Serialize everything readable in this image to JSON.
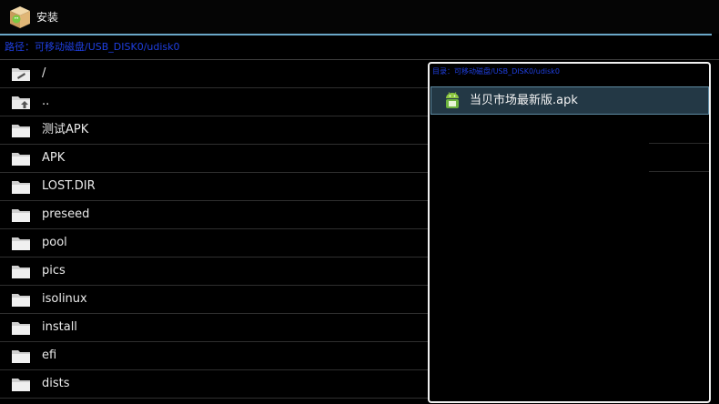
{
  "window": {
    "title": "安装",
    "icon": "package-box-icon"
  },
  "path": {
    "label": "路径：",
    "value": "可移动磁盘/USB_DISK0/udisk0"
  },
  "file_list": {
    "icon": "folder-icon",
    "items": [
      {
        "label": "/",
        "icon": "folder-root-icon"
      },
      {
        "label": "..",
        "icon": "folder-up-icon"
      },
      {
        "label": "测试APK",
        "icon": "folder-icon"
      },
      {
        "label": "APK",
        "icon": "folder-icon"
      },
      {
        "label": "LOST.DIR",
        "icon": "folder-icon"
      },
      {
        "label": "preseed",
        "icon": "folder-icon"
      },
      {
        "label": "pool",
        "icon": "folder-icon"
      },
      {
        "label": "pics",
        "icon": "folder-icon"
      },
      {
        "label": "isolinux",
        "icon": "folder-icon"
      },
      {
        "label": "install",
        "icon": "folder-icon"
      },
      {
        "label": "efi",
        "icon": "folder-icon"
      },
      {
        "label": "dists",
        "icon": "folder-icon"
      }
    ]
  },
  "apk_panel": {
    "header": "目录：可移动磁盘/USB_DISK0/udisk0",
    "items": [
      {
        "label": "当贝市场最新版.apk",
        "icon": "android-apk-icon",
        "selected": true
      }
    ]
  },
  "colors": {
    "accent": "#6aa7c8",
    "path_text": "#1f3fe0",
    "selection": "#233845"
  }
}
